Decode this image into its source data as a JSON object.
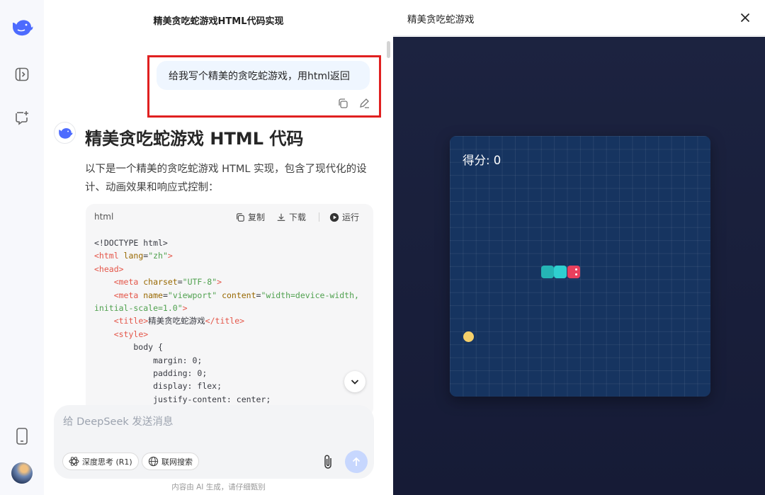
{
  "chat": {
    "title": "精美贪吃蛇游戏HTML代码实现",
    "user_message": "给我写个精美的贪吃蛇游戏，用html返回",
    "reply_heading": "精美贪吃蛇游戏 HTML 代码",
    "reply_intro": "以下是一个精美的贪吃蛇游戏 HTML 实现，包含了现代化的设计、动画效果和响应式控制："
  },
  "code_block": {
    "language": "html",
    "copy_label": "复制",
    "download_label": "下载",
    "run_label": "运行",
    "lines": [
      [
        {
          "c": "p",
          "t": "<!DOCTYPE html>"
        }
      ],
      [
        {
          "c": "t",
          "t": "<html"
        },
        {
          "c": "a",
          "t": " lang"
        },
        {
          "c": "p",
          "t": "="
        },
        {
          "c": "s",
          "t": "\"zh\""
        },
        {
          "c": "t",
          "t": ">"
        }
      ],
      [
        {
          "c": "t",
          "t": "<head>"
        }
      ],
      [
        {
          "c": "p",
          "t": "    "
        },
        {
          "c": "t",
          "t": "<meta"
        },
        {
          "c": "a",
          "t": " charset"
        },
        {
          "c": "p",
          "t": "="
        },
        {
          "c": "s",
          "t": "\"UTF-8\""
        },
        {
          "c": "t",
          "t": ">"
        }
      ],
      [
        {
          "c": "p",
          "t": "    "
        },
        {
          "c": "t",
          "t": "<meta"
        },
        {
          "c": "a",
          "t": " name"
        },
        {
          "c": "p",
          "t": "="
        },
        {
          "c": "s",
          "t": "\"viewport\""
        },
        {
          "c": "a",
          "t": " content"
        },
        {
          "c": "p",
          "t": "="
        },
        {
          "c": "s",
          "t": "\"width=device-width,"
        }
      ],
      [
        {
          "c": "s",
          "t": "initial-scale=1.0\""
        },
        {
          "c": "t",
          "t": ">"
        }
      ],
      [
        {
          "c": "p",
          "t": "    "
        },
        {
          "c": "t",
          "t": "<title>"
        },
        {
          "c": "p",
          "t": "精美贪吃蛇游戏"
        },
        {
          "c": "t",
          "t": "</title>"
        }
      ],
      [
        {
          "c": "p",
          "t": "    "
        },
        {
          "c": "t",
          "t": "<style>"
        }
      ],
      [
        {
          "c": "p",
          "t": "        body {"
        }
      ],
      [
        {
          "c": "p",
          "t": "            margin: 0;"
        }
      ],
      [
        {
          "c": "p",
          "t": "            padding: 0;"
        }
      ],
      [
        {
          "c": "p",
          "t": "            display: flex;"
        }
      ],
      [
        {
          "c": "p",
          "t": "            justify-content: center;"
        }
      ]
    ]
  },
  "input": {
    "placeholder": "给 DeepSeek 发送消息",
    "deep_think_label": "深度思考 (R1)",
    "web_search_label": "联网搜索"
  },
  "disclaimer": "内容由 AI 生成，请仔细甄别",
  "preview": {
    "title": "精美贪吃蛇游戏",
    "score_text": "得分: 0"
  },
  "icons": {
    "rail": [
      "deepseek-logo-icon",
      "sidebar-toggle-icon",
      "new-chat-icon",
      "mobile-app-icon"
    ],
    "message_actions": [
      "copy-icon",
      "edit-icon"
    ],
    "code_actions": [
      "copy-icon",
      "download-icon",
      "play-icon"
    ],
    "input": [
      "atom-icon",
      "globe-icon",
      "paperclip-icon",
      "send-arrow-icon"
    ]
  },
  "colors": {
    "brand_blue": "#4d6bfe",
    "highlight_red": "#e02020",
    "snake_body": "#2ec4c4",
    "snake_head": "#e8405d",
    "food": "#f5d06a",
    "board_bg": "#163460"
  }
}
